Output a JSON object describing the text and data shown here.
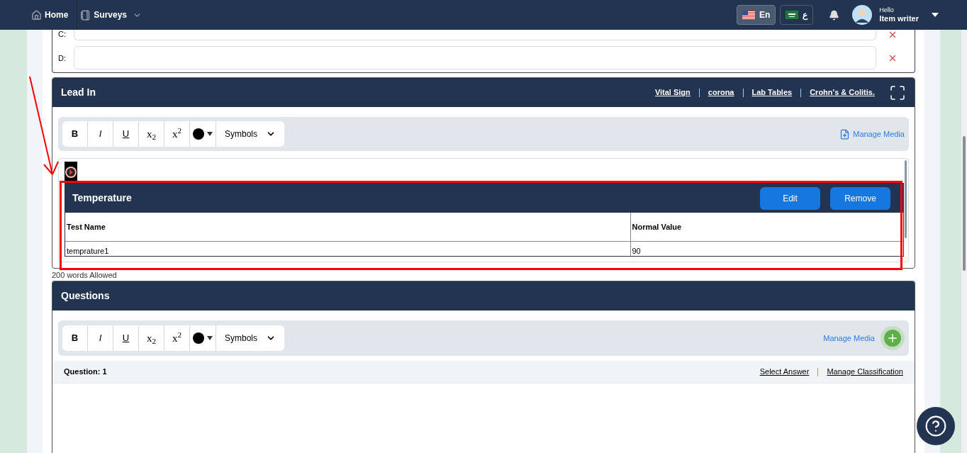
{
  "navbar": {
    "items": [
      {
        "label": "Home",
        "kind": "home"
      },
      {
        "label": "Surveys",
        "kind": "dropdown"
      }
    ],
    "languages": [
      {
        "label": "En",
        "kind": "us",
        "selected": true
      },
      {
        "label": "ع",
        "kind": "sa",
        "selected": false
      }
    ],
    "user": {
      "greeting": "Hello",
      "name": "Item writer"
    }
  },
  "options": [
    {
      "label": "C:"
    },
    {
      "label": "D:"
    }
  ],
  "lead_in": {
    "title": "Lead In",
    "links": [
      "Vital Sign",
      "corona",
      "Lab Tables",
      "Crohn's & Colitis."
    ],
    "toolbar": {
      "buttons": [
        {
          "label": "B",
          "kind": "bold"
        },
        {
          "label": "I",
          "kind": "italic"
        },
        {
          "label": "U",
          "kind": "underline"
        },
        {
          "label": "x$_{2}$",
          "kind": "sub"
        },
        {
          "label": "x$^{2}$",
          "kind": "sup"
        }
      ],
      "select": "Symbols"
    },
    "manage_media": "Manage Media",
    "table_card": {
      "title": "Temperature",
      "buttons": [
        "Edit",
        "Remove"
      ],
      "columns": [
        "Test Name",
        "Normal Value"
      ],
      "rows": [
        [
          "temprature1",
          "90"
        ]
      ]
    }
  },
  "word_limit": "200 words Allowed",
  "questions": {
    "title": "Questions",
    "toolbar": {
      "buttons": [
        {
          "label": "B",
          "kind": "bold"
        },
        {
          "label": "I",
          "kind": "italic"
        },
        {
          "label": "U",
          "kind": "underline"
        },
        {
          "label": "x$_{2}$",
          "kind": "sub"
        },
        {
          "label": "x$^{2}$",
          "kind": "sup"
        }
      ],
      "select": "Symbols"
    },
    "manage_media": "Manage Media",
    "question_label": "Question: 1",
    "links": [
      "Select Answer",
      "Manage Classification"
    ]
  }
}
